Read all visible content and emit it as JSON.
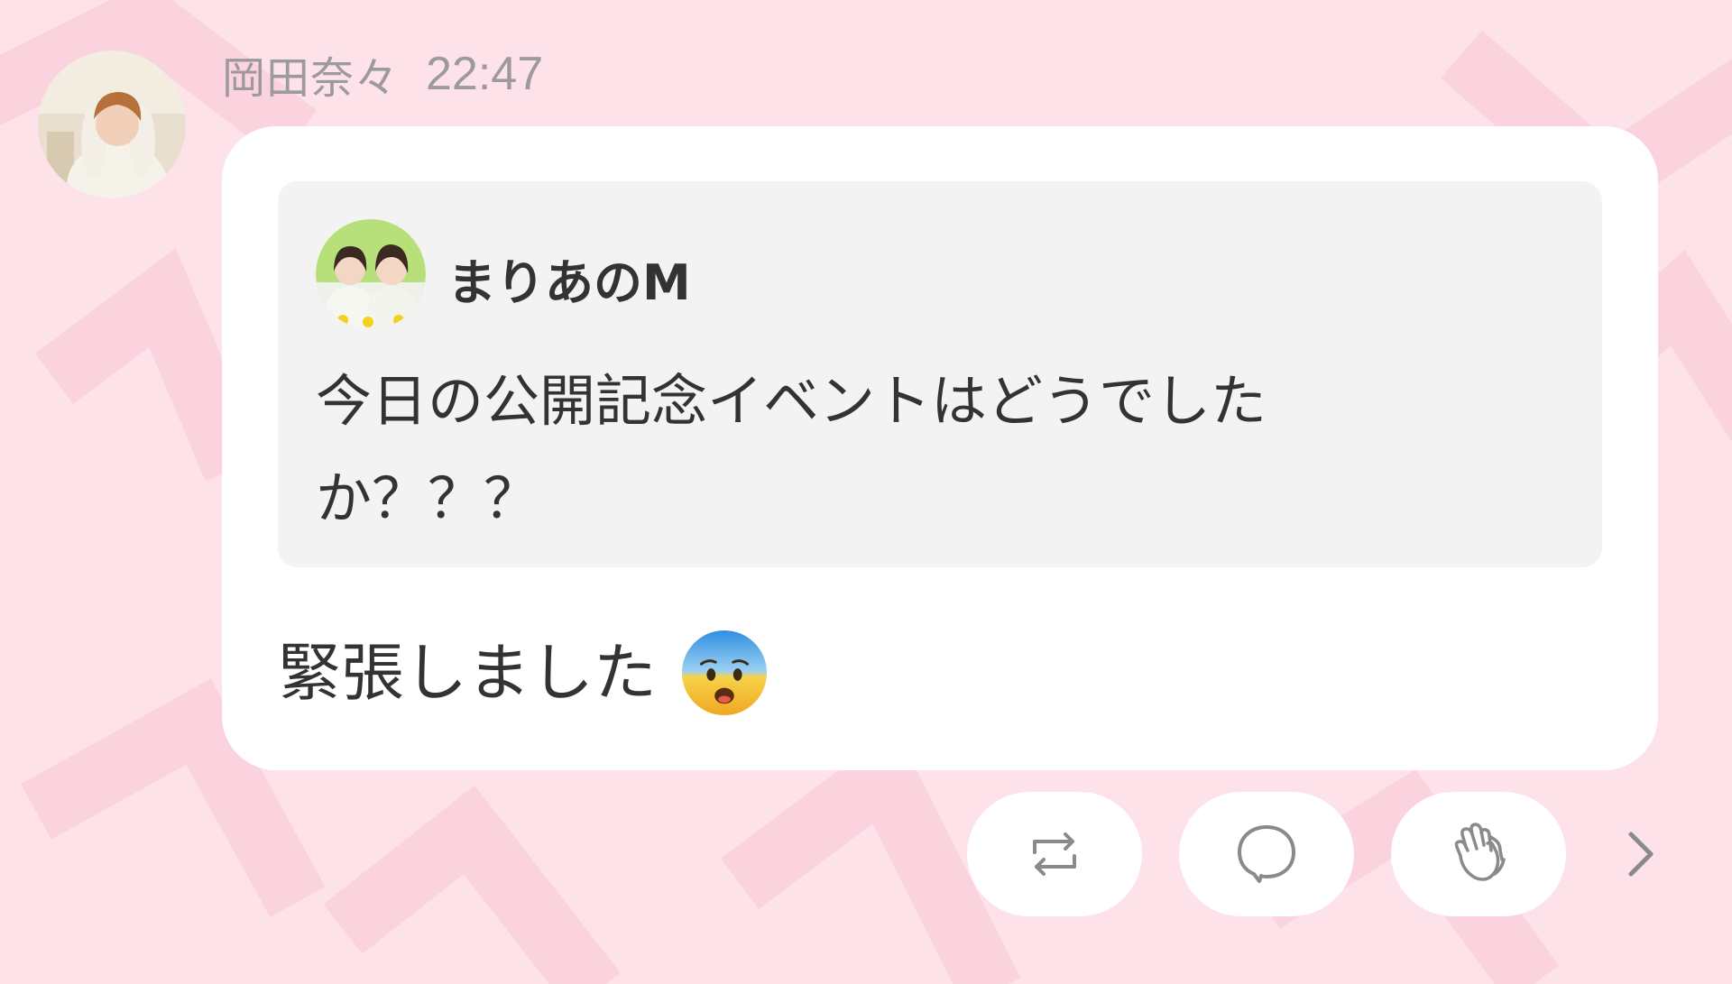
{
  "post": {
    "sender_name": "岡田奈々",
    "time": "22:47",
    "quote": {
      "author": "まりあのM",
      "text": "今日の公開記念イベントはどうでしたか？？？"
    },
    "message": "緊張しました",
    "emoji": "anxious-face-with-sweat-icon"
  },
  "actions": [
    {
      "name": "repost",
      "icon": "repost-icon"
    },
    {
      "name": "comment",
      "icon": "speech-bubble-icon"
    },
    {
      "name": "clap",
      "icon": "clapping-hands-icon"
    },
    {
      "name": "next",
      "icon": "chevron-right-icon"
    }
  ],
  "colors": {
    "background": "#fde2ea",
    "bubble": "#ffffff",
    "quote_background": "#f3f3f3",
    "meta_text": "#9c9a9b",
    "body_text": "#333333",
    "icon": "#8a8a8a"
  }
}
